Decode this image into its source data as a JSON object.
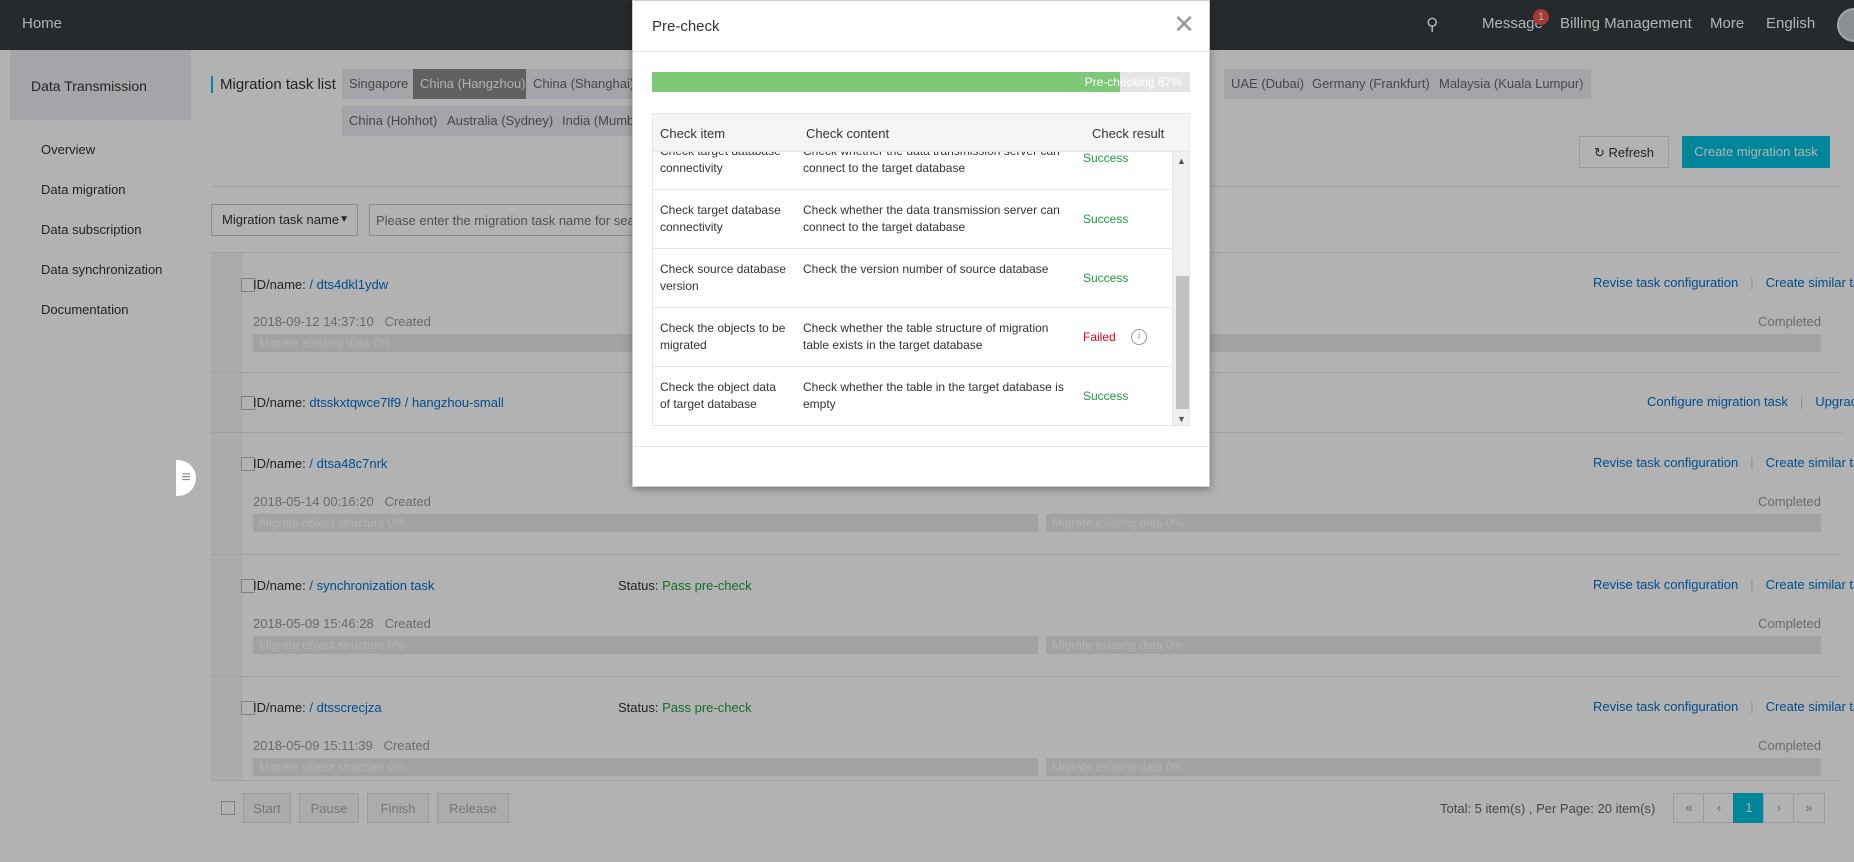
{
  "topbar": {
    "home": "Home",
    "message": "Message",
    "message_badge": "1",
    "billing": "Billing Management",
    "more": "More",
    "language": "English"
  },
  "sidebar": {
    "title": "Data Transmission",
    "items": [
      "Overview",
      "Data migration",
      "Data subscription",
      "Data synchronization",
      "Documentation"
    ]
  },
  "main": {
    "breadcrumb": "Migration task list",
    "regions_row1": [
      "Singapore",
      "China (Hangzhou)",
      "China (Shanghai)",
      "UAE (Dubai)",
      "Germany (Frankfurt)",
      "Malaysia (Kuala Lumpur)"
    ],
    "regions_row2": [
      "China (Hohhot)",
      "Australia (Sydney)",
      "India (Mumbai)"
    ],
    "refresh": "Refresh",
    "create": "Create migration task",
    "filter_select": "Migration task name",
    "search_placeholder": "Please enter the migration task name for search"
  },
  "tasks": [
    {
      "label": "ID/name:",
      "id": "/ dts4dkl1ydw",
      "date": "2018-09-12 14:37:10",
      "created": "Created",
      "status": "Completed",
      "actions": [
        "Revise task configuration",
        "Create similar task"
      ],
      "bar1": "Migrate existing data",
      "bar1_pct": "0%"
    },
    {
      "label": "ID/name:",
      "id": "dtsskxtqwce7lf9 / hangzhou-small",
      "actions": [
        "Configure migration task",
        "Upgrade"
      ]
    },
    {
      "label": "ID/name:",
      "id": "/ dtsa48c7nrk",
      "date": "2018-05-14 00:16:20",
      "created": "Created",
      "status": "Completed",
      "actions": [
        "Revise task configuration",
        "Create similar task"
      ],
      "bar1": "Migrate object structure",
      "bar1_pct": "0%",
      "bar2": "Migrate existing data",
      "bar2_pct": "0%"
    },
    {
      "label": "ID/name:",
      "id": "/ synchronization task",
      "status_label": "Status:",
      "status_value": "Pass pre-check",
      "date": "2018-05-09 15:46:28",
      "created": "Created",
      "status": "Completed",
      "actions": [
        "Revise task configuration",
        "Create similar task"
      ],
      "bar1": "Migrate object structure",
      "bar1_pct": "0%",
      "bar2": "Migrate existing data",
      "bar2_pct": "0%"
    },
    {
      "label": "ID/name:",
      "id": "/ dtsscrecjza",
      "status_label": "Status:",
      "status_value": "Pass pre-check",
      "date": "2018-05-09 15:11:39",
      "created": "Created",
      "status": "Completed",
      "actions": [
        "Revise task configuration",
        "Create similar task"
      ],
      "bar1": "Migrate object structure",
      "bar1_pct": "0%",
      "bar2": "Migrate existing data",
      "bar2_pct": "0%"
    }
  ],
  "footer": {
    "buttons": [
      "Start",
      "Pause",
      "Finish",
      "Release"
    ],
    "total": "Total: 5 item(s) ,  Per Page: 20 item(s)",
    "pages": [
      "«",
      "‹",
      "1",
      "›",
      "»"
    ]
  },
  "modal": {
    "title": "Pre-check",
    "progress_label": "Pre-checking 87%",
    "progress_value": 87,
    "columns": [
      "Check item",
      "Check content",
      "Check result"
    ],
    "rows": [
      {
        "item": "Check target database connectivity",
        "content": "Check whether the data transmission server can connect to the target database",
        "result": "Success"
      },
      {
        "item": "Check target database connectivity",
        "content": "Check whether the data transmission server can connect to the target database",
        "result": "Success"
      },
      {
        "item": "Check source database version",
        "content": "Check the version number of source database",
        "result": "Success"
      },
      {
        "item": "Check the objects to be migrated",
        "content": "Check whether the table structure of migration table exists in the target database",
        "result": "Failed"
      },
      {
        "item": "Check the object data of target database",
        "content": "Check whether the table in the target database is empty",
        "result": "Success"
      }
    ]
  },
  "colors": {
    "topbar": "#373d41",
    "accent": "#00c1de",
    "link": "#0070cc",
    "success": "#1e9e3d",
    "failed": "#e60012",
    "progress": "#7ec978"
  },
  "icons": [
    "search-icon",
    "refresh-icon",
    "close-icon",
    "info-icon",
    "caret-down-icon",
    "menu-toggle-icon"
  ]
}
